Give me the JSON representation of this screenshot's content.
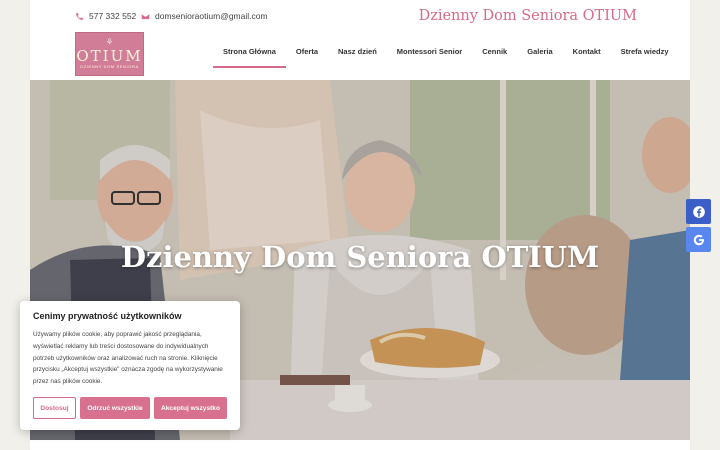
{
  "header": {
    "phone": "577 332 552",
    "email": "domsenioraotium@gmail.com",
    "title": "Dzienny Dom Seniora OTIUM"
  },
  "logo": {
    "word": "OTIUM",
    "subtitle": "DZIENNY DOM SENIORA"
  },
  "nav": {
    "items": [
      {
        "label": "Strona Główna",
        "active": true
      },
      {
        "label": "Oferta"
      },
      {
        "label": "Nasz dzień"
      },
      {
        "label": "Montessori Senior"
      },
      {
        "label": "Cennik"
      },
      {
        "label": "Galeria"
      },
      {
        "label": "Kontakt"
      },
      {
        "label": "Strefa wiedzy"
      }
    ]
  },
  "hero": {
    "title": "Dzienny Dom Seniora OTIUM"
  },
  "social": {
    "items": [
      {
        "icon": "facebook-icon"
      },
      {
        "icon": "google-icon"
      }
    ]
  },
  "cookie": {
    "title": "Cenimy prywatność użytkowników",
    "text": "Używamy plików cookie, aby poprawić jakość przeglądania, wyświetlać reklamy lub treści dostosowane do indywidualnych potrzeb użytkowników oraz analizować ruch na stronie. Kliknięcie przycisku „Akceptuj wszystkie\" oznacza zgodę na wykorzystywanie przez nas plików cookie.",
    "customize_label": "Dostosuj",
    "reject_label": "Odrzuć wszystkie",
    "accept_label": "Akceptuj wszystko"
  },
  "colors": {
    "accent": "#d86a8a",
    "facebook": "#3b5ec8",
    "google": "#5a86f0"
  }
}
